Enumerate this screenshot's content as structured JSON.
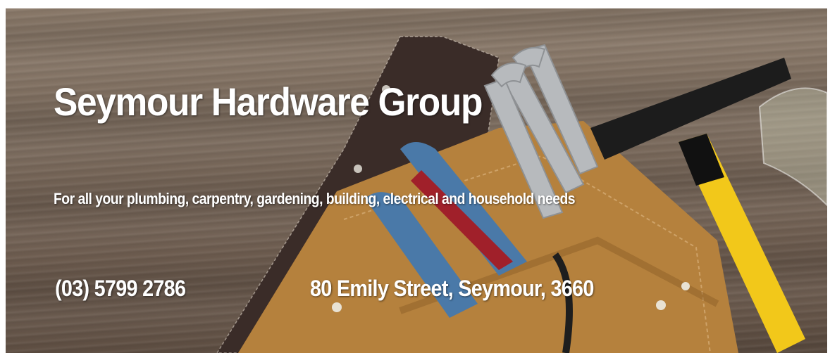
{
  "banner": {
    "title": "Seymour Hardware Group",
    "tagline": "For all your plumbing, carpentry, gardening, building, electrical and household needs",
    "phone": "(03) 5799 2786",
    "address": "80 Emily Street, Seymour, 3660"
  },
  "image": {
    "subject": "tool-belt-with-wrenches-pliers-hammer-on-wood",
    "colors": {
      "wood": "#7a6a5c",
      "leather": "#b8853f",
      "canvas_strap": "#3d2f2c",
      "plier_handle_blue": "#4a79a8",
      "plier_handle_red": "#a0202a",
      "hammer_handle": "#f2c81a",
      "hammer_head": "#1c1c1c",
      "steel": "#b9bcbf"
    }
  }
}
